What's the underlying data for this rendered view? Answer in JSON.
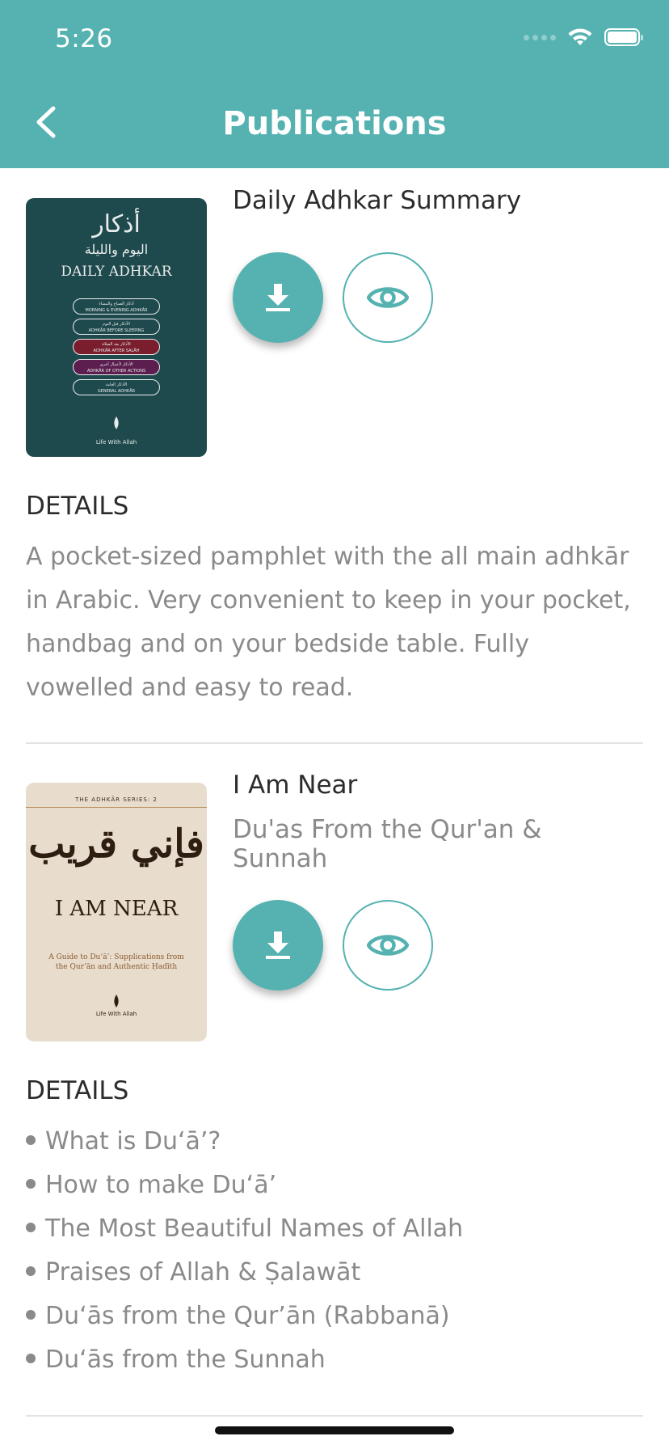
{
  "status_bar": {
    "time": "5:26"
  },
  "header": {
    "title": "Publications"
  },
  "publications": [
    {
      "title": "Daily Adhkar Summary",
      "subtitle": "",
      "details_label": "DETAILS",
      "details_text": "A pocket-sized pamphlet with the all main adhkār in Arabic. Very convenient to keep in your pocket, handbag and on your bedside table. Fully vowelled and easy to read.",
      "cover": {
        "arabic_title": "أذكار",
        "arabic_subtitle": "اليوم والليلة",
        "title": "DAILY ADHKAR",
        "pills": [
          {
            "arabic": "أذكار الصباح والمساء",
            "english": "MORNING & EVENING ADHKĀR"
          },
          {
            "arabic": "الأذكار قبل النوم",
            "english": "ADHKĀR BEFORE SLEEPING"
          },
          {
            "arabic": "الأذكار بعد الصلاة",
            "english": "ADHKĀR AFTER SALĀH"
          },
          {
            "arabic": "الأذكار لأعمال أخرى",
            "english": "ADHKĀR OF OTHER ACTIONS"
          },
          {
            "arabic": "الأذكار العامة",
            "english": "GENERAL ADHKĀR"
          }
        ],
        "brand": "Life With Allah"
      }
    },
    {
      "title": "I Am Near",
      "subtitle": "Du'as From the Qur'an & Sunnah",
      "details_label": "DETAILS",
      "details_bullets": [
        "What is Du‘ā’?",
        "How to make Du‘ā’",
        "The Most Beautiful Names of Allah",
        "Praises of Allah & Ṣalawāt",
        "Du‘ās from the Qur’ān (Rabbanā)",
        "Du‘ās from the Sunnah"
      ],
      "cover": {
        "series": "THE ADHKĀR SERIES: 2",
        "arabic_title": "فإني قريب",
        "title": "I AM NEAR",
        "subtitle": "A Guide to Du‘ā’: Supplications from the Qur’ān and Authentic Ḥadīth",
        "brand": "Life With Allah"
      }
    }
  ],
  "colors": {
    "primary": "#55b2b1",
    "text": "#2c2c2c",
    "muted": "#8a8a8a"
  },
  "icons": [
    "chevron-left-icon",
    "wifi-icon",
    "battery-icon",
    "download-icon",
    "eye-icon"
  ]
}
